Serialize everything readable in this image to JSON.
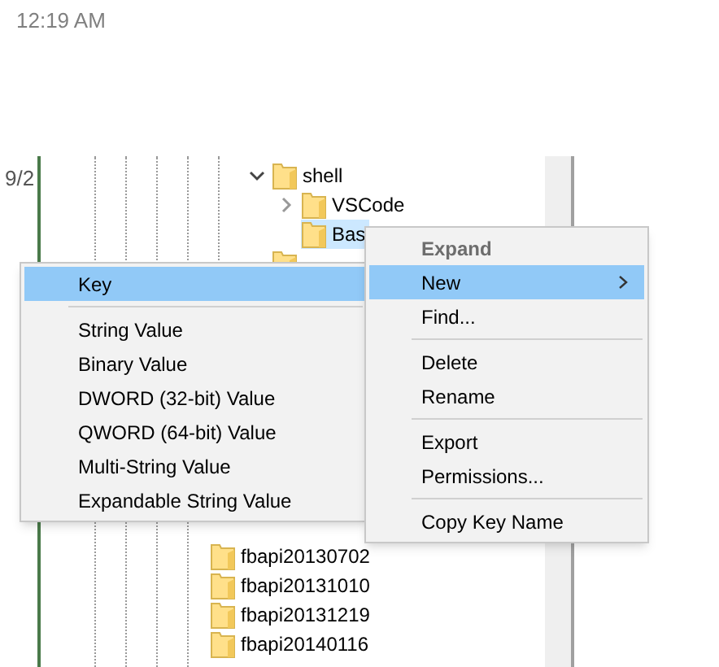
{
  "clock": "12:19 AM",
  "side_text": "9/2",
  "tree_upper": [
    {
      "label": "shell",
      "expanded": true,
      "selected": false,
      "children": [
        {
          "label": "VSCode",
          "expanded": false,
          "selected": false
        },
        {
          "label": "Bas",
          "selected": true
        }
      ]
    },
    {
      "selected": false
    }
  ],
  "tree_lower": [
    {
      "label": "fbapi20130702",
      "selected": false
    },
    {
      "label": "fbapi20131010",
      "selected": false
    },
    {
      "label": "fbapi20131219",
      "selected": false
    },
    {
      "label": "fbapi20140116",
      "selected": false
    }
  ],
  "context_menu": [
    {
      "kind": "default",
      "label": "Expand",
      "selected": false
    },
    {
      "kind": "submenu",
      "label": "New",
      "selected": true
    },
    {
      "kind": "item",
      "label": "Find...",
      "selected": false
    },
    {
      "kind": "separator"
    },
    {
      "kind": "item",
      "label": "Delete",
      "selected": false
    },
    {
      "kind": "item",
      "label": "Rename",
      "selected": false
    },
    {
      "kind": "separator"
    },
    {
      "kind": "item",
      "label": "Export",
      "selected": false
    },
    {
      "kind": "item",
      "label": "Permissions...",
      "selected": false
    },
    {
      "kind": "separator"
    },
    {
      "kind": "item",
      "label": "Copy Key Name",
      "selected": false
    }
  ],
  "submenu": [
    {
      "kind": "item",
      "label": "Key",
      "selected": true
    },
    {
      "kind": "separator"
    },
    {
      "kind": "item",
      "label": "String Value",
      "selected": false
    },
    {
      "kind": "item",
      "label": "Binary Value",
      "selected": false
    },
    {
      "kind": "item",
      "label": "DWORD (32-bit) Value",
      "selected": false
    },
    {
      "kind": "item",
      "label": "QWORD (64-bit) Value",
      "selected": false
    },
    {
      "kind": "item",
      "label": "Multi-String Value",
      "selected": false
    },
    {
      "kind": "item",
      "label": "Expandable String Value",
      "selected": false
    }
  ]
}
